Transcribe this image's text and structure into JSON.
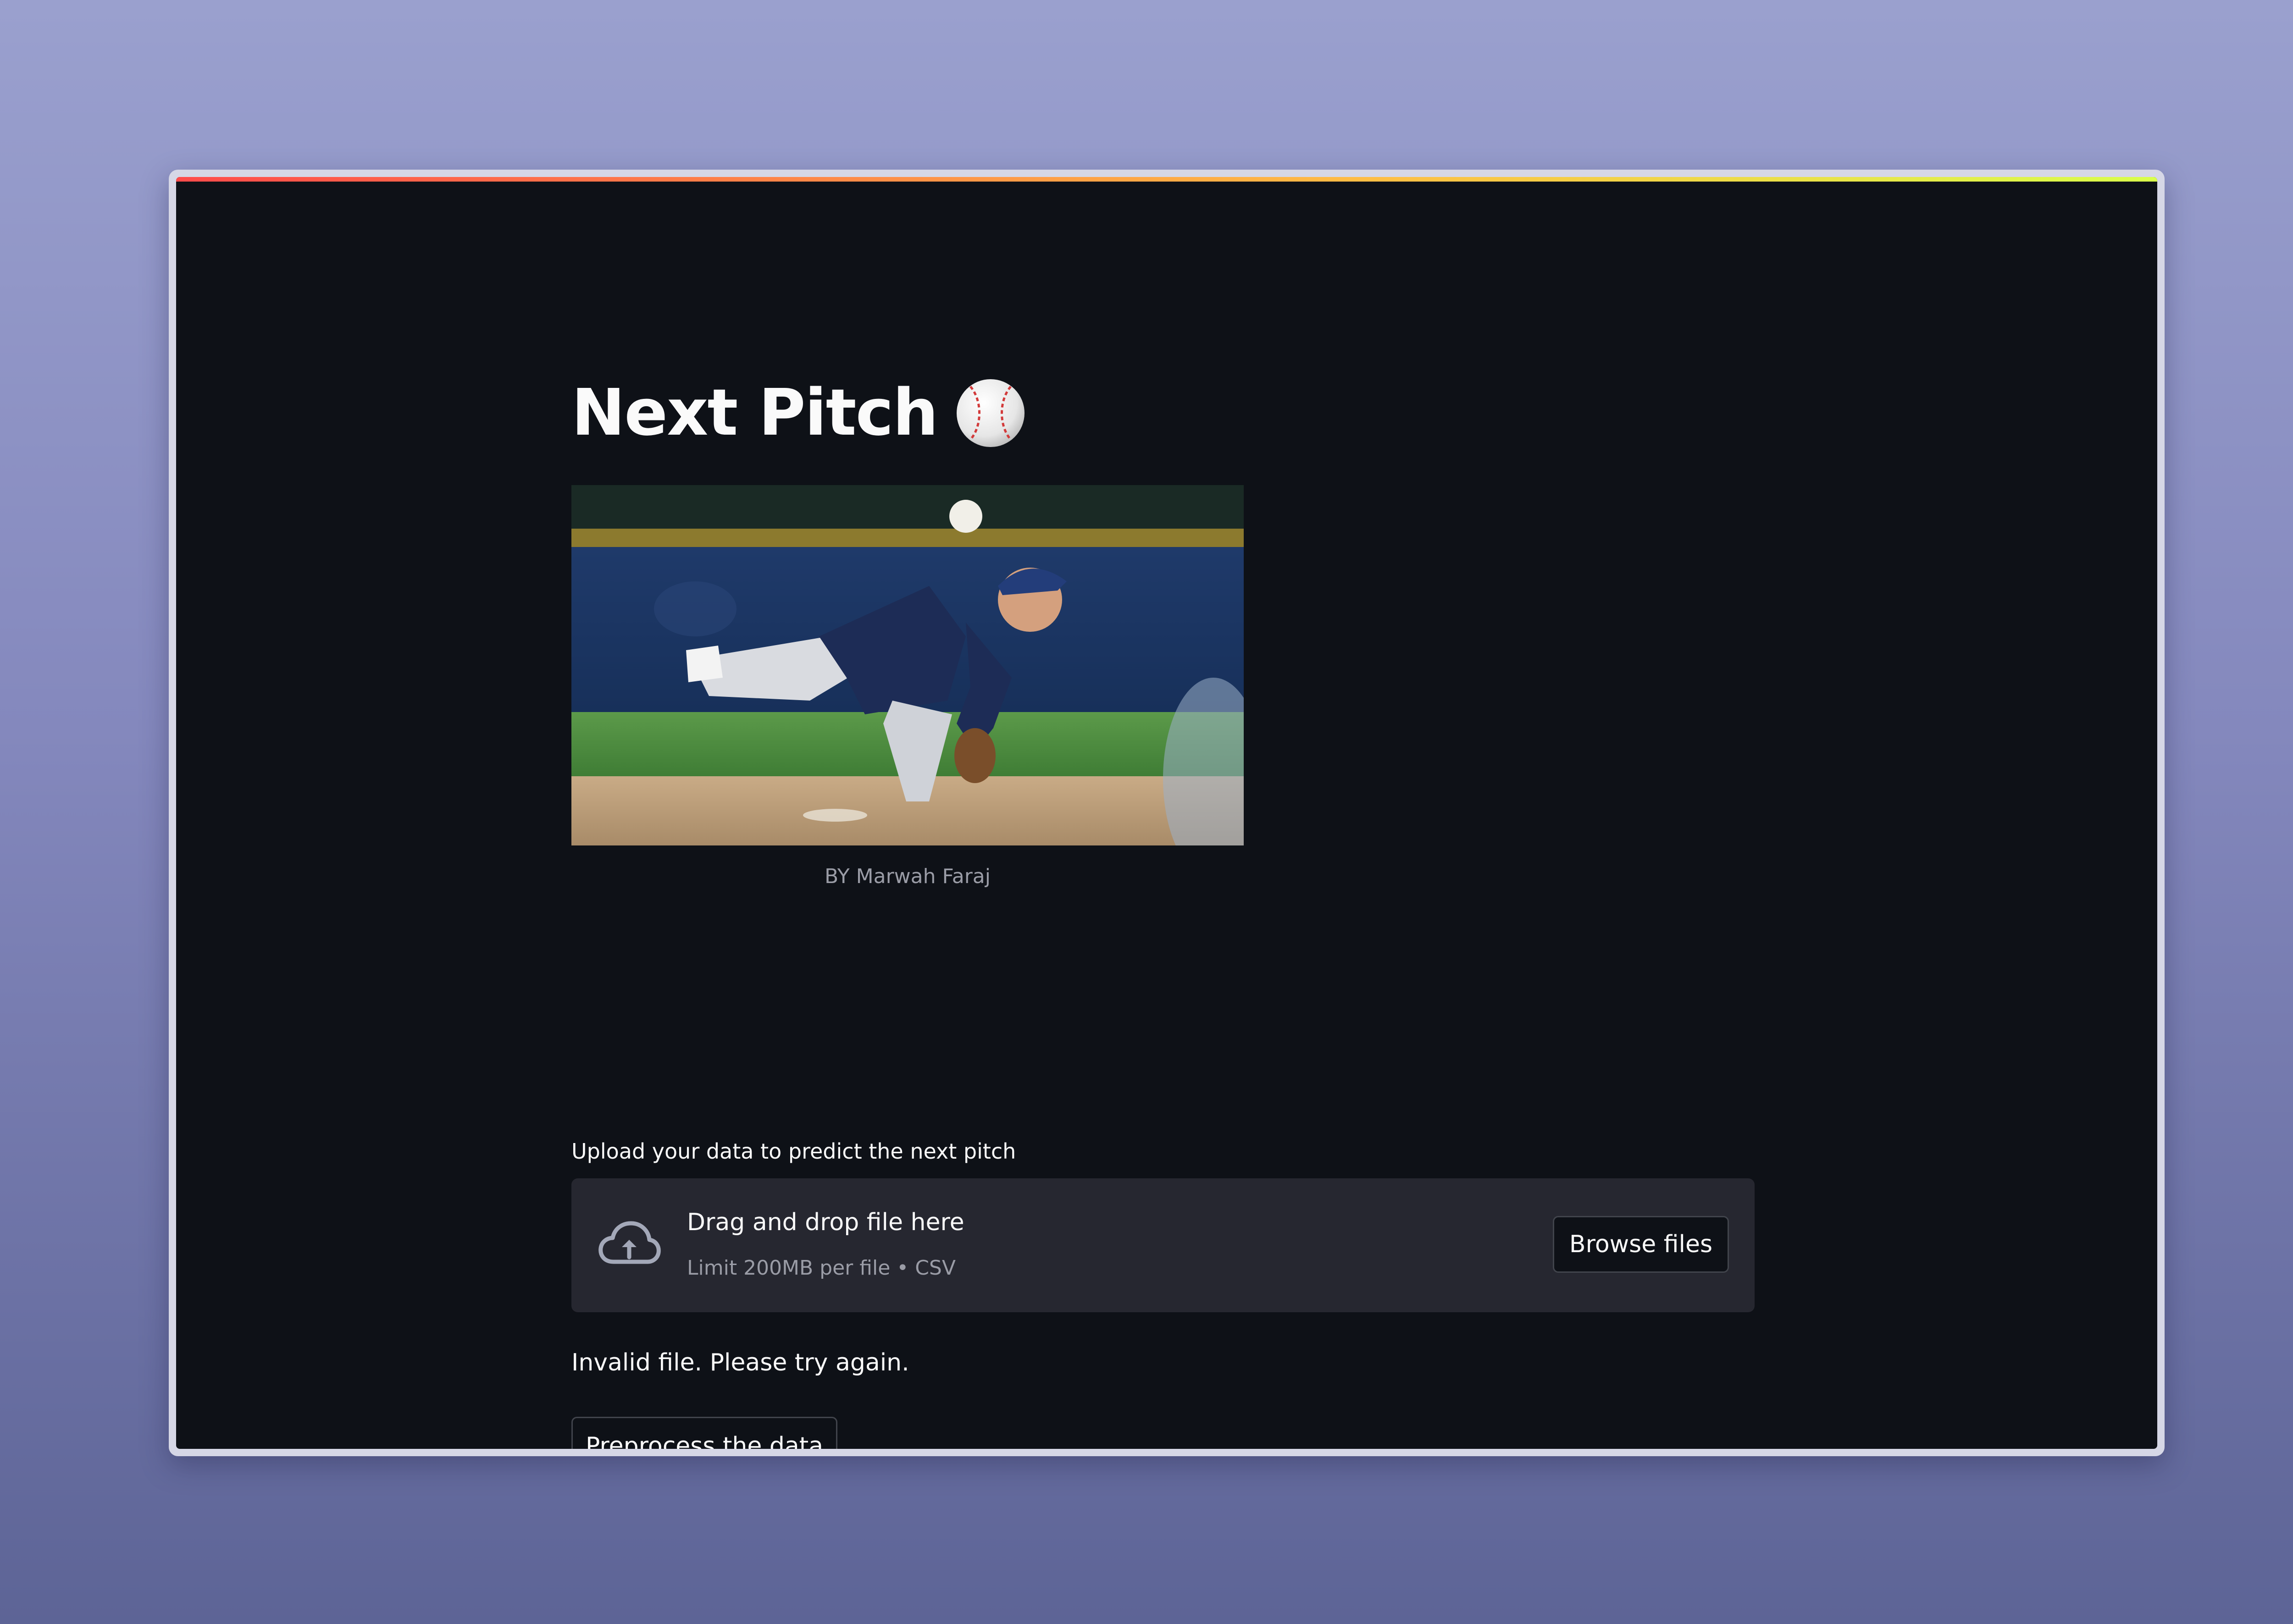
{
  "app": {
    "title": "Next Pitch",
    "title_emoji_icon": "baseball-icon",
    "image": {
      "icon": "baseball-pitcher-photo",
      "caption": "BY Marwah Faraj"
    },
    "uploader": {
      "label": "Upload your data to predict the next pitch",
      "dropzone_title": "Drag and drop file here",
      "dropzone_limit": "Limit 200MB per file • CSV",
      "icon": "cloud-upload-icon",
      "browse_label": "Browse files"
    },
    "status_message": "Invalid file. Please try again.",
    "preprocess_label": "Preprocess the data"
  },
  "colors": {
    "background": "#0e1117",
    "dropzone": "#262730",
    "text": "#fafafa",
    "muted_text": "#9a9ca6",
    "button_border": "#41444c",
    "accent_gradient_start": "#ff4b4b",
    "accent_gradient_end": "#d9ff4b"
  }
}
